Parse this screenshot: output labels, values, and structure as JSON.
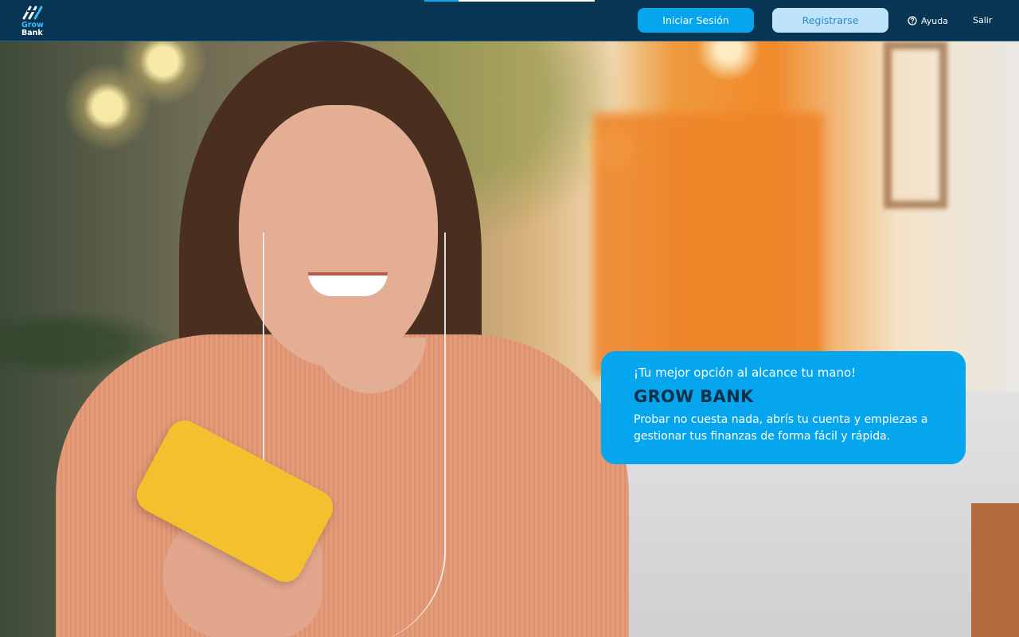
{
  "header": {
    "logo": {
      "line1": "Grow",
      "line2": "Bank",
      "icon": "growbank-logo-icon"
    },
    "buttons": {
      "login_label": "Iniciar Sesión",
      "register_label": "Registrarse"
    },
    "help": {
      "label": "Ayuda",
      "icon": "question-circle-icon"
    },
    "exit_label": "Salir"
  },
  "hero": {
    "image_description": "",
    "promo": {
      "tagline": "¡Tu mejor opción al alcance tu mano!",
      "title": "GROW BANK",
      "description": "Probar no cuesta nada, abrís tu cuenta y empiezas a gestionar tus finanzas de forma fácil y rápida."
    }
  },
  "colors": {
    "header_bg": "#073553",
    "accent": "#06a6ee",
    "register_bg": "#bde4fb",
    "promo_title": "#062f4b"
  }
}
